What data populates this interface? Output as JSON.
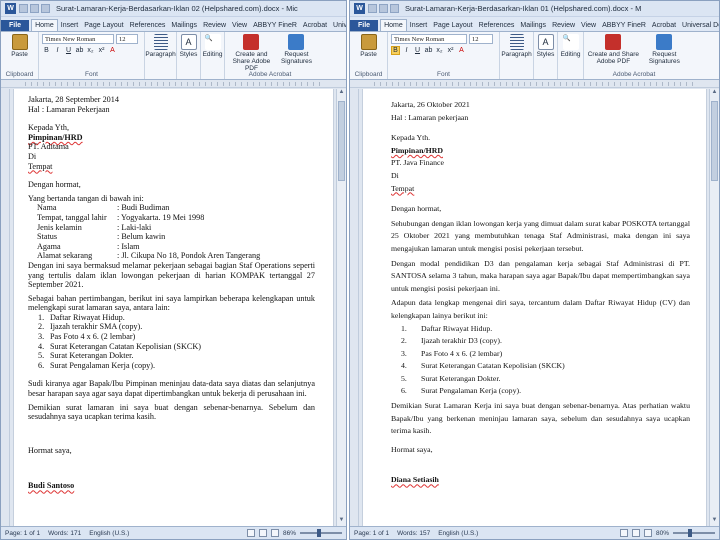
{
  "left": {
    "title": "Surat-Lamaran-Kerja-Berdasarkan-Iklan 02 (Helpshared.com).docx - Mic",
    "tabs": [
      "File",
      "Home",
      "Insert",
      "Page Layout",
      "References",
      "Mailings",
      "Review",
      "View",
      "ABBYY FineR",
      "Acrobat",
      "Universal Do"
    ],
    "font_name": "Times New Roman",
    "font_size": "12",
    "ribbon": {
      "paste": "Paste",
      "clipboard": "Clipboard",
      "font": "Font",
      "paragraph": "Paragraph",
      "styles": "Styles",
      "editing": "Editing",
      "create_pdf": "Create and Share Adobe PDF",
      "request_sig": "Request Signatures",
      "adobe_acrobat": "Adobe Acrobat"
    },
    "doc": {
      "date": "Jakarta, 28 September 2014",
      "hal": "Hal : Lamaran Pekerjaan",
      "kepada": "Kepada Yth,",
      "pimpinan": "Pimpinan/HRD",
      "pt": "PT. Aditama",
      "di": "Di",
      "tempat": "Tempat",
      "salam": "Dengan hormat,",
      "intro": "Yang bertanda tangan di bawah ini:",
      "fields": [
        [
          "Nama",
          ": Budi Budiman"
        ],
        [
          "Tempat, tanggal lahir",
          ": Yogyakarta. 19 Mei 1998"
        ],
        [
          "Jenis kelamin",
          ": Laki-laki"
        ],
        [
          "Status",
          ": Belum kawin"
        ],
        [
          "Agama",
          ": Islam"
        ],
        [
          "Alamat sekarang",
          ": Jl. Cikupa No 18, Pondok Aren Tangerang"
        ]
      ],
      "p1": "Dengan ini saya bermaksud melamar pekerjaan sebagai bagian Staf Operations seperti yang tertulis dalam iklan lowongan pekerjaan di harian KOMPAK tertanggal 27 September 2021.",
      "p2": "Sebagai bahan pertimbangan, berikut ini saya lampirkan beberapa kelengkapan untuk melengkapi surat lamaran saya, antara lain:",
      "list": [
        "Daftar Riwayat Hidup.",
        "Ijazah terakhir SMA (copy).",
        "Pas Foto 4 x 6. (2 lembar)",
        "Surat Keterangan Catatan Kepolisian (SKCK)",
        "Surat Keterangan Dokter.",
        "Surat Pengalaman Kerja (copy)."
      ],
      "p3": "Sudi kiranya agar Bapak/Ibu Pimpinan meninjau data-data saya diatas dan selanjutnya besar harapan saya agar saya dapat dipertimbangkan untuk bekerja di perusahaan ini.",
      "p4": "Demikian surat lamaran ini saya buat dengan sebenar-benarnya. Sebelum dan sesudahnya saya ucapkan terima kasih.",
      "closing": "Hormat saya,",
      "sign": "Budi Santoso"
    },
    "status": {
      "page": "Page: 1 of 1",
      "words": "Words: 171",
      "lang": "English (U.S.)",
      "zoom": "86%"
    }
  },
  "right": {
    "title": "Surat-Lamaran-Kerja-Berdasarkan-Iklan 01 (Helpshared.com).docx - M",
    "tabs": [
      "File",
      "Home",
      "Insert",
      "Page Layout",
      "References",
      "Mailings",
      "Review",
      "View",
      "ABBYY FineR",
      "Acrobat",
      "Universal Dc"
    ],
    "font_name": "Times New Roman",
    "font_size": "12",
    "ribbon": {
      "paste": "Paste",
      "clipboard": "Clipboard",
      "font": "Font",
      "paragraph": "Paragraph",
      "styles": "Styles",
      "editing": "Editing",
      "create_pdf": "Create and Share Adobe PDF",
      "request_sig": "Request Signatures",
      "adobe_acrobat": "Adobe Acrobat"
    },
    "doc": {
      "date": "Jakarta, 26 Oktober 2021",
      "hal": "Hal : Lamaran pekerjaan",
      "kepada": "Kepada Yth.",
      "pimpinan": "Pimpinan/HRD",
      "pt": "PT. Java Finance",
      "di": "Di",
      "tempat": "Tempat",
      "salam": "Dengan hormat,",
      "p1": "Sehubungan dengan iklan lowongan kerja yang dimuat dalam surat kabar POSKOTA tertanggal 25 Oktober 2021 yang membutuhkan tenaga Staf Administrasi, maka dengan ini saya mengajukan lamaran untuk mengisi posisi pekerjaan tersebut.",
      "p2": "Dengan modal pendidikan D3 dan pengalaman kerja sebagai Staf Administrasi di PT. SANTOSA selama 3 tahun, maka harapan saya agar Bapak/Ibu dapat mempertimbangkan saya untuk mengisi posisi pekerjaan ini.",
      "p3": "Adapun data lengkap mengenai diri saya, tercantum dalam Daftar Riwayat Hidup (CV) dan kelengkapan lainya berikut ini:",
      "list": [
        "Daftar Riwayat Hidup.",
        "Ijazah terakhir D3 (copy).",
        "Pas Foto 4 x 6. (2 lembar)",
        "Surat Keterangan Catatan Kepolisian (SKCK)",
        "Surat Keterangan Dokter.",
        "Surat Pengalaman Kerja (copy)."
      ],
      "p4": "Demikian Surat Lamaran Kerja ini saya buat dengan sebenar-benarnya. Atas perhatian waktu Bapak/Ibu yang berkenan meninjau lamaran saya, sebelum dan sesudahnya saya ucapkan terima kasih.",
      "closing": "Hormat saya,",
      "sign": "Diana Setiasih"
    },
    "status": {
      "page": "Page: 1 of 1",
      "words": "Words: 157",
      "lang": "English (U.S.)",
      "zoom": "80%"
    }
  }
}
